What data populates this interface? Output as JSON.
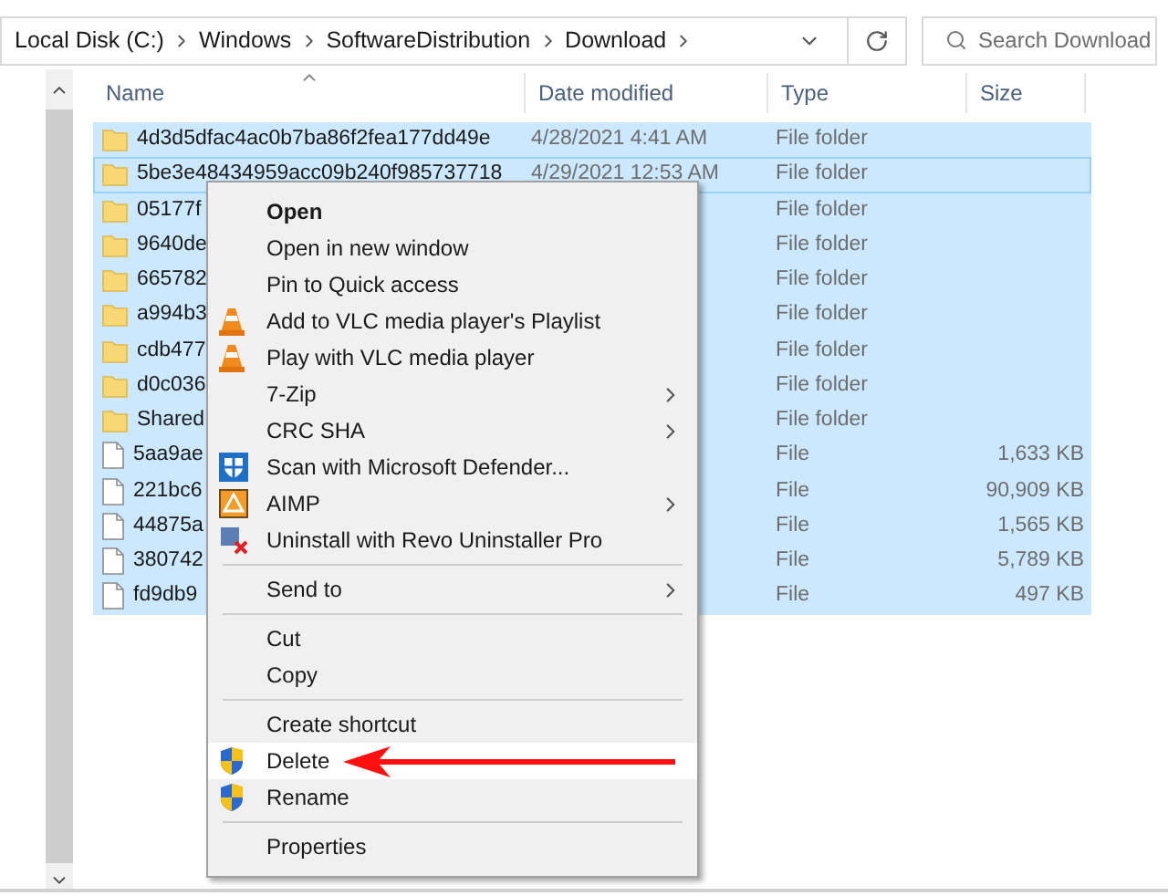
{
  "address_bar": {
    "crumbs": [
      "Local Disk (C:)",
      "Windows",
      "SoftwareDistribution",
      "Download"
    ]
  },
  "search": {
    "placeholder": "Search Download"
  },
  "columns": [
    "Name",
    "Date modified",
    "Type",
    "Size"
  ],
  "rows": [
    {
      "kind": "folder",
      "name": "4d3d5dfac4ac0b7ba86f2fea177dd49e",
      "date": "4/28/2021 4:41 AM",
      "type": "File folder",
      "size": "",
      "selected": true,
      "focused": false
    },
    {
      "kind": "folder",
      "name": "5be3e48434959acc09b240f985737718",
      "date": "4/29/2021 12:53 AM",
      "type": "File folder",
      "size": "",
      "selected": true,
      "focused": true
    },
    {
      "kind": "folder",
      "name": "05177f",
      "type": "File folder",
      "size": "",
      "selected": true,
      "focused": false
    },
    {
      "kind": "folder",
      "name": "9640de",
      "type": "File folder",
      "size": "",
      "selected": true,
      "focused": false
    },
    {
      "kind": "folder",
      "name": "665782",
      "type": "File folder",
      "size": "",
      "selected": true,
      "focused": false
    },
    {
      "kind": "folder",
      "name": "a994b3",
      "type": "File folder",
      "size": "",
      "selected": true,
      "focused": false
    },
    {
      "kind": "folder",
      "name": "cdb477",
      "type": "File folder",
      "size": "",
      "selected": true,
      "focused": false
    },
    {
      "kind": "folder",
      "name": "d0c036",
      "type": "File folder",
      "size": "",
      "selected": true,
      "focused": false
    },
    {
      "kind": "folder",
      "name": "Shared",
      "type": "File folder",
      "size": "",
      "selected": true,
      "focused": false
    },
    {
      "kind": "file",
      "name": "5aa9ae",
      "type": "File",
      "size": "1,633 KB",
      "selected": true,
      "focused": false
    },
    {
      "kind": "file",
      "name": "221bc6",
      "type": "File",
      "size": "90,909 KB",
      "selected": true,
      "focused": false
    },
    {
      "kind": "file",
      "name": "44875a",
      "type": "File",
      "size": "1,565 KB",
      "selected": true,
      "focused": false
    },
    {
      "kind": "file",
      "name": "380742",
      "type": "File",
      "size": "5,789 KB",
      "selected": true,
      "focused": false
    },
    {
      "kind": "file",
      "name": "fd9db9",
      "type": "File",
      "size": "497 KB",
      "selected": true,
      "focused": false
    }
  ],
  "context_menu": {
    "items": [
      {
        "kind": "plain",
        "label": "Open",
        "submenu": false,
        "default": true,
        "highlighted": false
      },
      {
        "kind": "plain",
        "label": "Open in new window",
        "submenu": false,
        "default": false,
        "highlighted": false
      },
      {
        "kind": "plain",
        "label": "Pin to Quick access",
        "submenu": false,
        "default": false,
        "highlighted": false
      },
      {
        "kind": "cone",
        "label": "Add to VLC media player's Playlist",
        "submenu": false,
        "default": false,
        "highlighted": false
      },
      {
        "kind": "cone",
        "label": "Play with VLC media player",
        "submenu": false,
        "default": false,
        "highlighted": false
      },
      {
        "kind": "plain",
        "label": "7-Zip",
        "submenu": true,
        "default": false,
        "highlighted": false
      },
      {
        "kind": "plain",
        "label": "CRC SHA",
        "submenu": true,
        "default": false,
        "highlighted": false
      },
      {
        "kind": "scanner",
        "label": "Scan with Microsoft Defender...",
        "submenu": false,
        "default": false,
        "highlighted": false
      },
      {
        "kind": "tile",
        "label": "AIMP",
        "submenu": true,
        "default": false,
        "highlighted": false
      },
      {
        "kind": "uninstaller",
        "label": "Uninstall with Revo Uninstaller Pro",
        "submenu": false,
        "default": false,
        "highlighted": false
      },
      {
        "kind": "separator"
      },
      {
        "kind": "plain",
        "label": "Send to",
        "submenu": true,
        "default": false,
        "highlighted": false
      },
      {
        "kind": "separator"
      },
      {
        "kind": "plain",
        "label": "Cut",
        "submenu": false,
        "default": false,
        "highlighted": false
      },
      {
        "kind": "plain",
        "label": "Copy",
        "submenu": false,
        "default": false,
        "highlighted": false
      },
      {
        "kind": "separator"
      },
      {
        "kind": "plain",
        "label": "Create shortcut",
        "submenu": false,
        "default": false,
        "highlighted": false
      },
      {
        "kind": "shield",
        "label": "Delete",
        "submenu": false,
        "default": false,
        "highlighted": true
      },
      {
        "kind": "shield",
        "label": "Rename",
        "submenu": false,
        "default": false,
        "highlighted": false
      },
      {
        "kind": "separator"
      },
      {
        "kind": "plain",
        "label": "Properties",
        "submenu": false,
        "default": false,
        "highlighted": false
      }
    ]
  }
}
